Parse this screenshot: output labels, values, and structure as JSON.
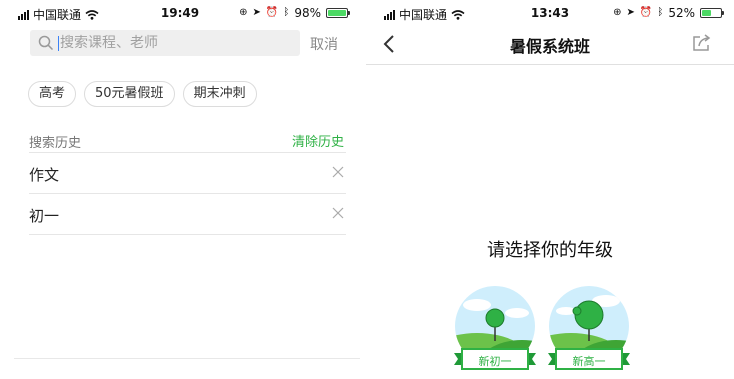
{
  "left": {
    "status": {
      "carrier": "中国联通",
      "time": "19:49",
      "battery": "98%",
      "battery_level": 0.98
    },
    "search": {
      "placeholder": "搜索课程、老师",
      "cancel": "取消"
    },
    "hot_tags": [
      "高考",
      "50元暑假班",
      "期末冲刺"
    ],
    "history": {
      "title": "搜索历史",
      "clear": "清除历史",
      "items": [
        "作文",
        "初一"
      ]
    }
  },
  "right": {
    "status": {
      "carrier": "中国联通",
      "time": "13:43",
      "battery": "52%",
      "battery_level": 0.52
    },
    "nav": {
      "title": "暑假系统班"
    },
    "prompt": "请选择你的年级",
    "grades": [
      "新初一",
      "新高一"
    ]
  },
  "colors": {
    "accent": "#2fb145",
    "battery_fill": "#4cd964"
  }
}
